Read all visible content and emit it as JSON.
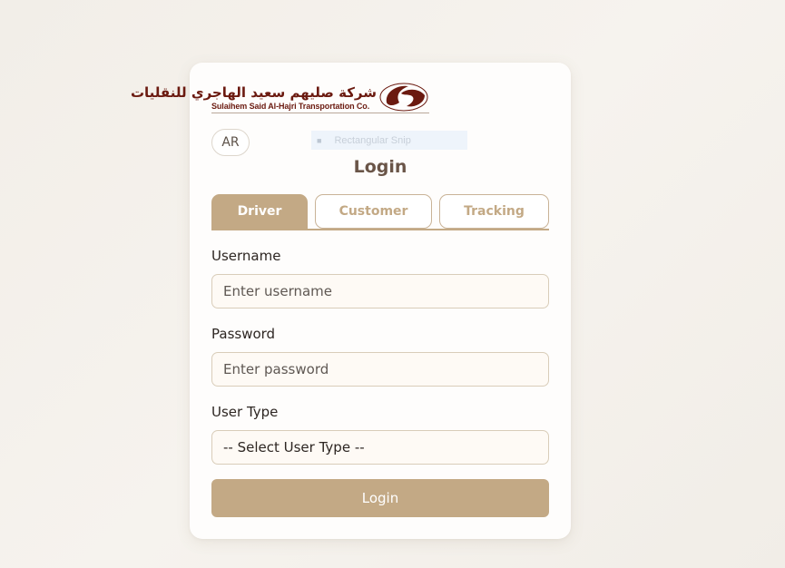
{
  "logo": {
    "arabic_name": "شركة صليهم سعيد الهاجري للنقليات",
    "english_name": "Sulaihem Said Al-Hajri Transportation Co.",
    "brand_color": "#6b1a10"
  },
  "language_toggle": {
    "label": "AR"
  },
  "snip_overlay": {
    "label": "Rectangular Snip",
    "icon": "snip-icon"
  },
  "page": {
    "title": "Login"
  },
  "tabs": [
    {
      "label": "Driver",
      "active": true
    },
    {
      "label": "Customer",
      "active": false
    },
    {
      "label": "Tracking",
      "active": false
    }
  ],
  "form": {
    "username": {
      "label": "Username",
      "placeholder": "Enter username",
      "value": ""
    },
    "password": {
      "label": "Password",
      "placeholder": "Enter password",
      "value": ""
    },
    "user_type": {
      "label": "User Type",
      "selected": "-- Select User Type --"
    },
    "submit_label": "Login"
  },
  "colors": {
    "accent": "#c3a985",
    "title": "#6a5548",
    "field_bg": "#fefaf5",
    "field_border": "#d9cdb9"
  }
}
